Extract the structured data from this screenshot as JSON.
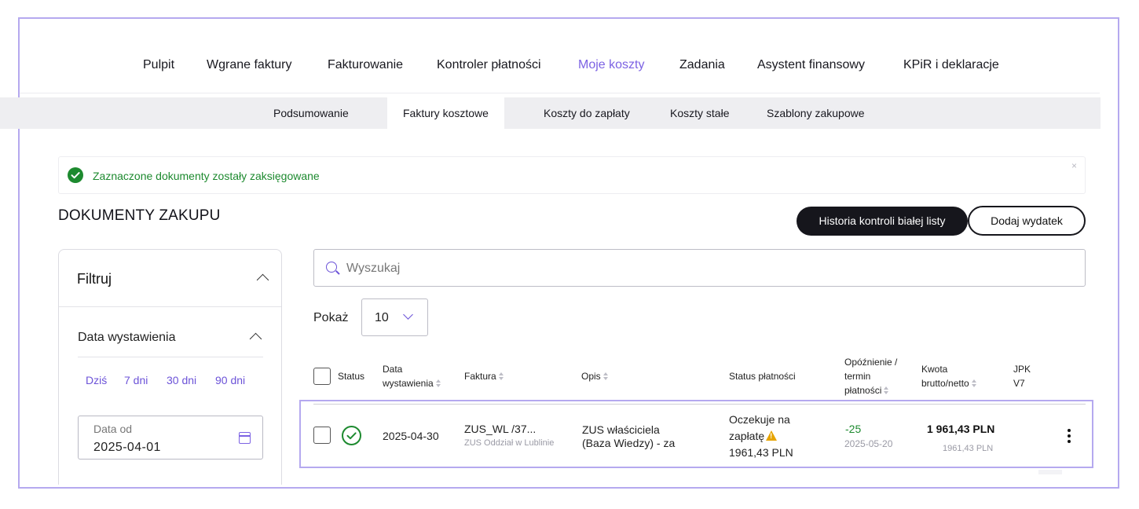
{
  "topnav": {
    "items": [
      "Pulpit",
      "Wgrane faktury",
      "Fakturowanie",
      "Kontroler płatności",
      "Moje koszty",
      "Zadania",
      "Asystent finansowy",
      "KPiR i deklaracje"
    ],
    "active": "Moje koszty"
  },
  "subnav": {
    "tabs": [
      "Podsumowanie",
      "Faktury kosztowe",
      "Koszty do zapłaty",
      "Koszty stałe",
      "Szablony zakupowe"
    ],
    "active": "Faktury kosztowe"
  },
  "alert": {
    "message": "Zaznaczone dokumenty zostały zaksięgowane",
    "close": "×",
    "color": "#1d8a2f"
  },
  "page": {
    "title": "DOKUMENTY ZAKUPU",
    "history_button": "Historia kontroli białej listy",
    "add_button": "Dodaj wydatek"
  },
  "filter": {
    "title": "Filtruj",
    "date_section": "Data wystawienia",
    "quick": [
      "Dziś",
      "7 dni",
      "30 dni",
      "90 dni"
    ],
    "date_from_label": "Data od",
    "date_from_value": "2025-04-01"
  },
  "search": {
    "placeholder": "Wyszukaj"
  },
  "pager": {
    "label": "Pokaż",
    "value": "10"
  },
  "table": {
    "headers": {
      "status": "Status",
      "date_l1": "Data",
      "date_l2": "wystawienia",
      "invoice": "Faktura",
      "description": "Opis",
      "payment_status": "Status płatności",
      "delay_l1": "Opóźnienie /",
      "delay_l2": "termin",
      "delay_l3": "płatności",
      "amount_l1": "Kwota",
      "amount_l2": "brutto/netto",
      "jpk_l1": "JPK",
      "jpk_l2": "V7"
    },
    "rows": [
      {
        "date": "2025-04-30",
        "invoice_number": "ZUS_WL /37...",
        "invoice_issuer": "ZUS Oddział w Lublinie",
        "description_l1": "ZUS właściciela",
        "description_l2": "(Baza Wiedzy) - za",
        "payment_status_l1": "Oczekuje na",
        "payment_status_l2": "zapłatę",
        "payment_status_amount": "1961,43 PLN",
        "delay": "-25",
        "due_date": "2025-05-20",
        "gross": "1 961,43",
        "gross_currency": "PLN",
        "net": "1961,43 PLN"
      }
    ]
  },
  "colors": {
    "accent": "#7c62e3",
    "success": "#1d8a2f",
    "warning": "#e6a400",
    "highlight_frame": "#b5a9ef"
  }
}
